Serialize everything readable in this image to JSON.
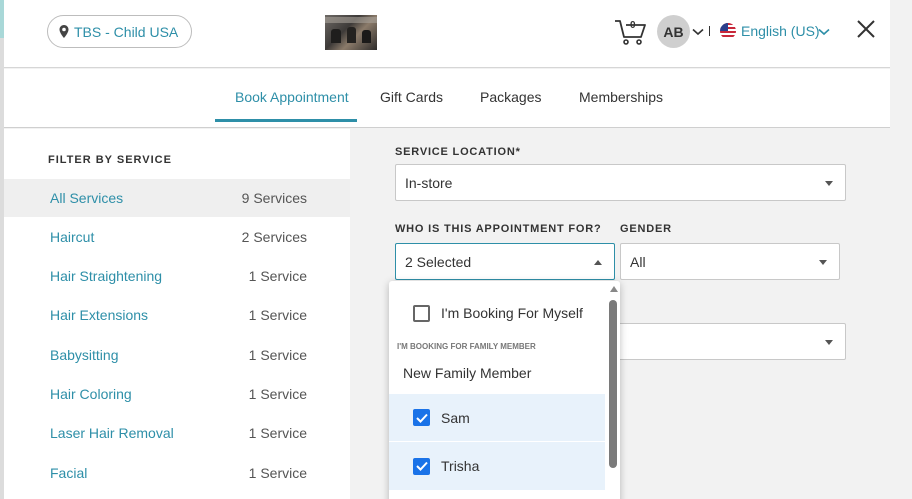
{
  "header": {
    "location": "TBS - Child USA",
    "cart_count": "0",
    "avatar_initials": "AB",
    "language": "English (US)"
  },
  "tabs": [
    {
      "label": "Book Appointment",
      "active": true
    },
    {
      "label": "Gift Cards",
      "active": false
    },
    {
      "label": "Packages",
      "active": false
    },
    {
      "label": "Memberships",
      "active": false
    }
  ],
  "sidebar": {
    "title": "FILTER BY SERVICE",
    "items": [
      {
        "name": "All Services",
        "count": "9 Services"
      },
      {
        "name": "Haircut",
        "count": "2 Services"
      },
      {
        "name": "Hair Straightening",
        "count": "1 Service"
      },
      {
        "name": "Hair Extensions",
        "count": "1 Service"
      },
      {
        "name": "Babysitting",
        "count": "1 Service"
      },
      {
        "name": "Hair Coloring",
        "count": "1 Service"
      },
      {
        "name": "Laser Hair Removal",
        "count": "1 Service"
      },
      {
        "name": "Facial",
        "count": "1 Service"
      }
    ]
  },
  "form": {
    "service_location_label": "SERVICE LOCATION*",
    "service_location_value": "In-store",
    "appointment_for_label": "WHO IS THIS APPOINTMENT FOR?",
    "appointment_for_value": "2 Selected",
    "gender_label": "GENDER",
    "gender_value": "All"
  },
  "dropdown": {
    "myself_label": "I'm Booking For Myself",
    "group_label": "I'M BOOKING FOR FAMILY MEMBER",
    "new_member_label": "New Family Member",
    "members": [
      {
        "name": "Sam",
        "checked": true
      },
      {
        "name": "Trisha",
        "checked": true
      }
    ]
  },
  "colors": {
    "accent": "#2e8fa8",
    "checkbox": "#1a73e8"
  }
}
